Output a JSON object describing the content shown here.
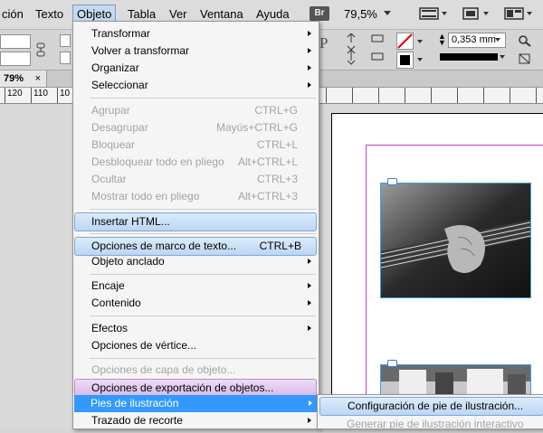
{
  "menubar": {
    "items": [
      "ción",
      "Texto",
      "Objeto",
      "Tabla",
      "Ver",
      "Ventana",
      "Ayuda"
    ],
    "bridge_badge": "Br",
    "zoom": "79,5%"
  },
  "control_panel": {
    "stroke_weight": "0,353 mm"
  },
  "tabs": {
    "document_zoom": "79%",
    "close": "×"
  },
  "ruler": {
    "labels": [
      "120",
      "110",
      "10"
    ]
  },
  "menu": {
    "items": [
      {
        "label": "Transformar",
        "submenu": true
      },
      {
        "label": "Volver a transformar",
        "submenu": true
      },
      {
        "label": "Organizar",
        "submenu": true
      },
      {
        "label": "Seleccionar",
        "submenu": true
      },
      {
        "label": "Agrupar",
        "shortcut": "CTRL+G",
        "disabled": true
      },
      {
        "label": "Desagrupar",
        "shortcut": "Mayús+CTRL+G",
        "disabled": true
      },
      {
        "label": "Bloquear",
        "shortcut": "CTRL+L",
        "disabled": true
      },
      {
        "label": "Desbloquear todo en pliego",
        "shortcut": "Alt+CTRL+L",
        "disabled": true
      },
      {
        "label": "Ocultar",
        "shortcut": "CTRL+3",
        "disabled": true
      },
      {
        "label": "Mostrar todo en pliego",
        "shortcut": "Alt+CTRL+3",
        "disabled": true
      },
      {
        "label": "Insertar HTML..."
      },
      {
        "label": "Opciones de marco de texto...",
        "shortcut": "CTRL+B"
      },
      {
        "label": "Objeto anclado",
        "submenu": true
      },
      {
        "label": "Encaje",
        "submenu": true
      },
      {
        "label": "Contenido",
        "submenu": true
      },
      {
        "label": "Efectos",
        "submenu": true
      },
      {
        "label": "Opciones de vértice..."
      },
      {
        "label": "Opciones de capa de objeto...",
        "disabled": true
      },
      {
        "label": "Opciones de exportación de objetos..."
      },
      {
        "label": "Pies de ilustración",
        "submenu": true
      },
      {
        "label": "Trazado de recorte",
        "submenu": true
      }
    ]
  },
  "submenu": {
    "items": [
      {
        "label": "Configuración de pie de ilustración..."
      },
      {
        "label": "Generar pie de ilustración interactivo",
        "disabled": true
      }
    ]
  }
}
